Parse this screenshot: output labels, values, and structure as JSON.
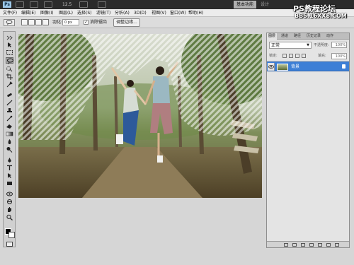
{
  "appbar": {
    "logo": "Ps",
    "zoom": "12.5",
    "workspace_active": "基本功能",
    "workspace_design": "设计"
  },
  "menu": [
    "文件(F)",
    "编辑(E)",
    "图像(I)",
    "图层(L)",
    "选择(S)",
    "滤镜(T)",
    "分析(A)",
    "3D(D)",
    "视图(V)",
    "窗口(W)",
    "帮助(H)"
  ],
  "options": {
    "feather_label": "羽化:",
    "feather_value": "0 px",
    "antialias_checked": "✓",
    "antialias_label": "消除锯齿",
    "refine_edge": "调整边缘..."
  },
  "layers_panel": {
    "tabs": [
      "图层",
      "通道",
      "路径",
      "历史记录",
      "动作"
    ],
    "blend_mode": "正常",
    "opacity_label": "不透明度:",
    "opacity_value": "100%",
    "lock_label": "锁定:",
    "fill_label": "填充:",
    "fill_value": "100%",
    "layer_name": "背景"
  },
  "watermark": {
    "line1": "PS教程论坛",
    "line2": "BBS.16XX8.COM"
  },
  "colors": {
    "foreground": "#000000",
    "background": "#ffffff",
    "selected_layer": "#3d7fd6"
  },
  "icons": [
    "lasso-icon",
    "move-icon",
    "marquee-icon",
    "eye-icon",
    "lock-icon"
  ]
}
